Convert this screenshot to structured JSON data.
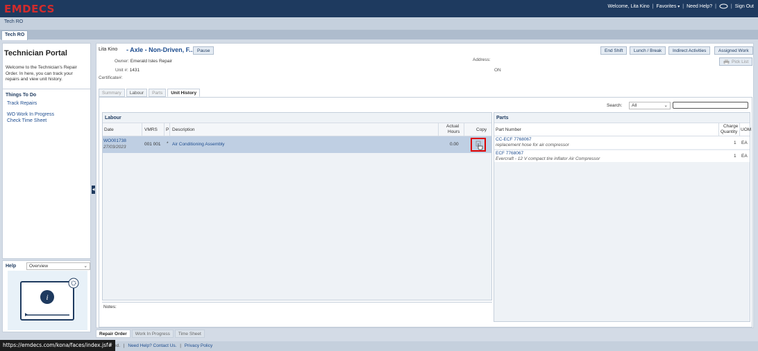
{
  "app": {
    "logo": "EMDECS"
  },
  "topnav": {
    "welcome": "Welcome, Lita Kino",
    "favorites": "Favorites",
    "help": "Need Help?",
    "signout": "Sign Out"
  },
  "subbar": {
    "title": "Tech RO"
  },
  "tabbar": {
    "active_tab": "Tech RO"
  },
  "left": {
    "title": "Technician Portal",
    "desc": "Welcome to the Technician's Repair Order. In here, you can track your repairs and view unit history.",
    "todo_title": "Things To Do",
    "todo_items": [
      "Track Repairs",
      "WO Work In Progress",
      "Check Time Sheet"
    ],
    "help_label": "Help",
    "help_select": "Overview"
  },
  "header": {
    "name": "Lita Kino",
    "title": "- Axle - Non-Driven, F...",
    "pause": "Pause",
    "owner_label": "Owner:",
    "owner": "Emerald Isles Repair",
    "unit_label": "Unit #:",
    "unit": "1431",
    "cert_label": "Certificate#:",
    "address_label": "Address:",
    "address_value": "ON",
    "buttons": [
      "End Shift",
      "Lunch / Break",
      "Indirect Activities",
      "Assigned Work"
    ],
    "pick_list": "Pick List"
  },
  "subtabs": [
    "Summary",
    "Labour",
    "Parts",
    "Unit History"
  ],
  "search": {
    "label": "Search:",
    "value": "All"
  },
  "labour": {
    "title": "Labour",
    "cols": {
      "date": "Date",
      "vmrs": "VMRS",
      "p": "P",
      "desc": "Description",
      "hours1": "Actual",
      "hours2": "Hours",
      "copy": "Copy"
    },
    "row": {
      "wo": "WO001738",
      "date": "27/03/2023",
      "vmrs": "001 001",
      "p": "*",
      "desc": "Air Conditioning Assembly",
      "hours": "0.00"
    }
  },
  "parts": {
    "title": "Parts",
    "cols": {
      "part": "Part Number",
      "qty1": "Charge",
      "qty2": "Quantity",
      "uom": "UOM"
    },
    "rows": [
      {
        "number": "CC-ECF 7768067",
        "desc": "replacement hose for air compressor",
        "qty": "1",
        "uom": "EA"
      },
      {
        "number": "ECF 7768067",
        "desc": "Evercraft - 12 V compact tire inflator Air Compressor",
        "qty": "1",
        "uom": "EA"
      }
    ]
  },
  "notes_label": "Notes:",
  "bottomtabs": [
    "Repair Order",
    "Work In Progress",
    "Time Sheet"
  ],
  "footer": {
    "text": "ed.",
    "help": "Need Help? Contact Us.",
    "privacy": "Privacy Policy"
  },
  "status_url": "https://emdecs.com/kona/faces/index.jsf#"
}
